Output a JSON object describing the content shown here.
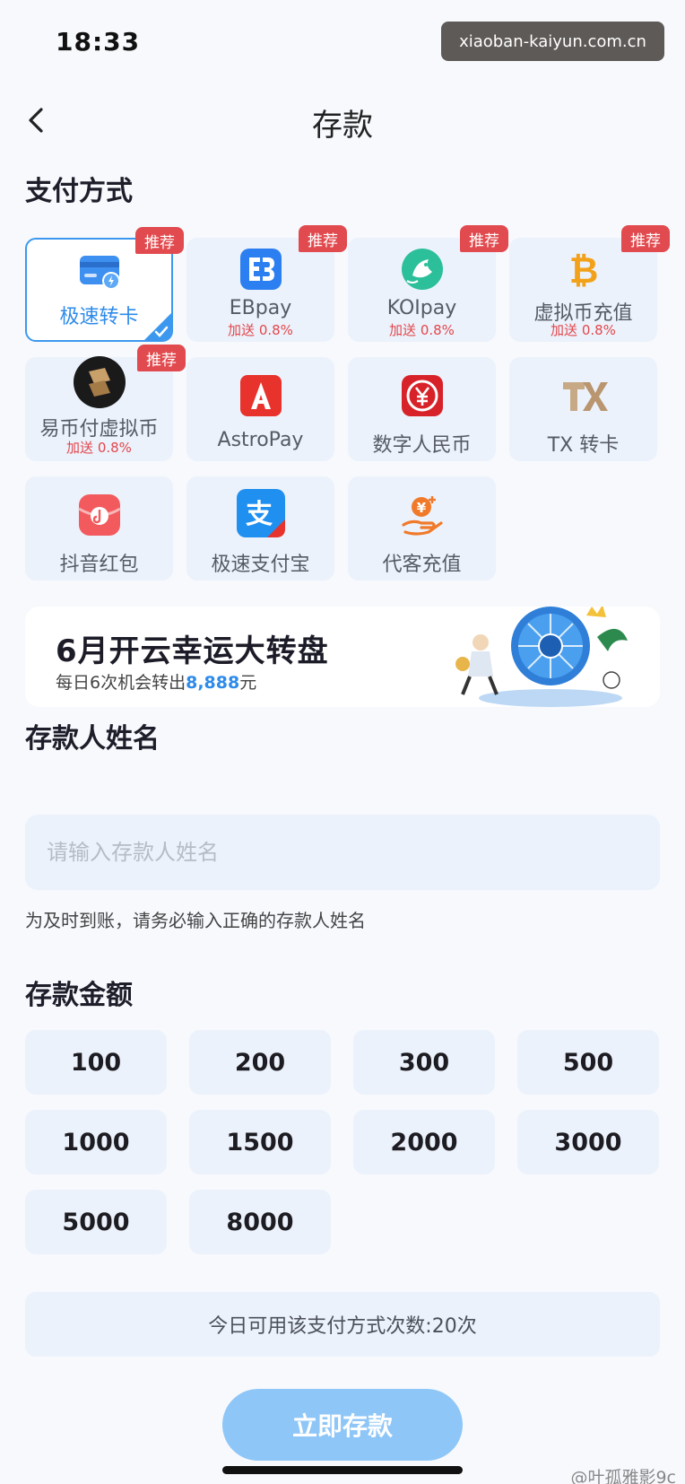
{
  "status_bar": {
    "time": "18:33"
  },
  "watermark": {
    "top": "xiaoban-kaiyun.com.cn",
    "bottom": "@叶孤雅影9c"
  },
  "header": {
    "title": "存款"
  },
  "payment": {
    "section_title": "支付方式",
    "badge_label": "推荐",
    "methods": [
      {
        "label": "极速转卡",
        "bonus": "",
        "recommended": true,
        "selected": true,
        "icon": "bank-card-lightning-icon"
      },
      {
        "label": "EBpay",
        "bonus": "加送 0.8%",
        "recommended": true,
        "selected": false,
        "icon": "ebpay-logo-icon"
      },
      {
        "label": "KOIpay",
        "bonus": "加送 0.8%",
        "recommended": true,
        "selected": false,
        "icon": "koi-fish-icon"
      },
      {
        "label": "虚拟币充值",
        "bonus": "加送 0.8%",
        "recommended": true,
        "selected": false,
        "icon": "bitcoin-icon"
      },
      {
        "label": "易币付虚拟币",
        "bonus": "加送 0.8%",
        "recommended": true,
        "selected": false,
        "icon": "yibifu-logo-icon"
      },
      {
        "label": "AstroPay",
        "bonus": "",
        "recommended": false,
        "selected": false,
        "icon": "astropay-logo-icon"
      },
      {
        "label": "数字人民币",
        "bonus": "",
        "recommended": false,
        "selected": false,
        "icon": "digital-rmb-icon"
      },
      {
        "label": "TX 转卡",
        "bonus": "",
        "recommended": false,
        "selected": false,
        "icon": "tx-logo-icon"
      },
      {
        "label": "抖音红包",
        "bonus": "",
        "recommended": false,
        "selected": false,
        "icon": "douyin-redpacket-icon"
      },
      {
        "label": "极速支付宝",
        "bonus": "",
        "recommended": false,
        "selected": false,
        "icon": "alipay-icon"
      },
      {
        "label": "代客充值",
        "bonus": "",
        "recommended": false,
        "selected": false,
        "icon": "hand-coin-icon"
      }
    ]
  },
  "banner": {
    "title": "6月开云幸运大转盘",
    "subtitle_prefix": "每日6次机会转出",
    "subtitle_amount": "8,888",
    "subtitle_suffix": "元"
  },
  "depositor": {
    "section_title": "存款人姓名",
    "placeholder": "请输入存款人姓名",
    "value": "",
    "hint": "为及时到账，请务必输入正确的存款人姓名"
  },
  "amount": {
    "section_title": "存款金额",
    "options": [
      "100",
      "200",
      "300",
      "500",
      "1000",
      "1500",
      "2000",
      "3000",
      "5000",
      "8000"
    ]
  },
  "usage": {
    "text": "今日可用该支付方式次数:20次"
  },
  "submit": {
    "label": "立即存款"
  },
  "colors": {
    "accent": "#2e8bea",
    "badge": "#e14a4e",
    "card_bg": "#ecf2fb",
    "submit_bg": "#8ec6f7"
  }
}
